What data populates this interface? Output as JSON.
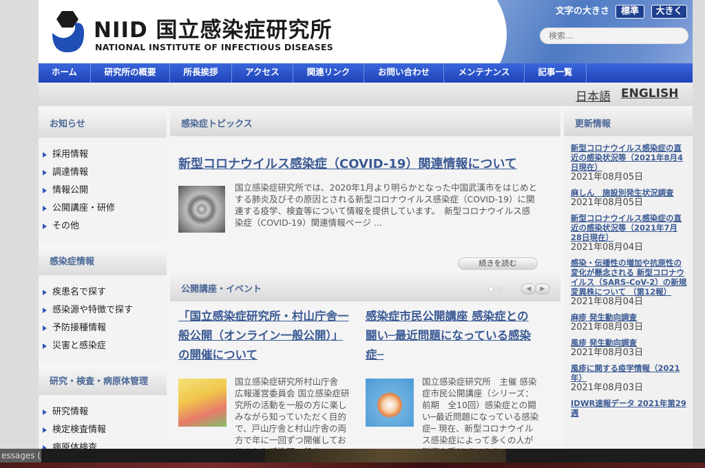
{
  "header": {
    "title": "NIID 国立感染症研究所",
    "subtitle": "NATIONAL INSTITUTE OF INFECTIOUS DISEASES",
    "font_size_label": "文字の大きさ",
    "font_standard": "標準",
    "font_large": "大きく",
    "search_placeholder": "検索..."
  },
  "nav": {
    "items": [
      "ホーム",
      "研究所の概要",
      "所長挨拶",
      "アクセス",
      "関連リンク",
      "お問い合わせ",
      "メンテナンス",
      "記事一覧"
    ]
  },
  "lang": {
    "ja": "日本語",
    "en": "ENGLISH"
  },
  "left": {
    "news": {
      "title": "お知らせ",
      "items": [
        "採用情報",
        "調達情報",
        "情報公開",
        "公開講座・研修",
        "その他"
      ]
    },
    "disease": {
      "title": "感染症情報",
      "items": [
        "疾患名で探す",
        "感染源や特徴で探す",
        "予防接種情報",
        "災害と感染症"
      ]
    },
    "research": {
      "title": "研究・検査・病原体管理",
      "items": [
        "研究情報",
        "検定検査情報",
        "病原体検査"
      ]
    }
  },
  "topics": {
    "title": "感染症トピックス",
    "headline": "新型コロナウイルス感染症（COVID-19）関連情報について",
    "text": "国立感染症研究所では、2020年1月より明らかとなった中国武漢市をはじめとする肺炎及びその原因とされる新型コロナウイルス感染症（COVID-19）に関連する疫学、検査等について情報を提供しています。　新型コロナウイルス感染症（COVID-19）関連情報ページ ...",
    "read_more": "続きを読む"
  },
  "events": {
    "title": "公開講座・イベント",
    "items": [
      {
        "title": "「国立感染症研究所・村山庁舎一般公開（オンライン一般公開）」の開催について",
        "text": "国立感染症研究所村山庁舎　広報運営委員会 国立感染症研究所の活動を一般の方に楽しみながら知っていただく目的で、戸山庁舎と村山庁舎の両方で年に一回ずつ開催しておりました感染研一般公"
      },
      {
        "title": "感染症市民公開講座 感染症との闘い─最近問題になっている感染症─",
        "text": "国立感染症研究所　主催 感染症市民公開講座（シリーズ：前期　全10回）感染症との闘い─最近問題になっている感染症─ 現在、新型コロナウイルス感染症によって多くの人が影響を受けています"
      }
    ]
  },
  "updates": {
    "title": "更新情報",
    "items": [
      {
        "title": "新型コロナウイルス感染症の直近の感染状況等（2021年8月4日現在）",
        "date": "2021年08月05日"
      },
      {
        "title": "麻しん　施設別発生状況調査",
        "date": "2021年08月05日"
      },
      {
        "title": "新型コロナウイルス感染症の直近の感染状況等（2021年7月28日現在）",
        "date": "2021年08月04日"
      },
      {
        "title": "感染・伝播性の増加や抗原性の変化が懸念される 新型コロナウイルス（SARS-CoV-2）の新規変異株について （第12報）",
        "date": "2021年08月04日"
      },
      {
        "title": "麻疹 発生動向調査",
        "date": "2021年08月03日"
      },
      {
        "title": "風疹 発生動向調査",
        "date": "2021年08月03日"
      },
      {
        "title": "風疹に関する疫学情報（2021年）",
        "date": "2021年08月03日"
      },
      {
        "title": "IDWR速報データ 2021年第29週",
        "date": ""
      }
    ]
  },
  "taskbar": {
    "tab_label": "essages (j..."
  },
  "colors": {
    "nav": "#2a52c8",
    "accent": "#3b5a94",
    "header_bg": "#4f7bc4"
  }
}
